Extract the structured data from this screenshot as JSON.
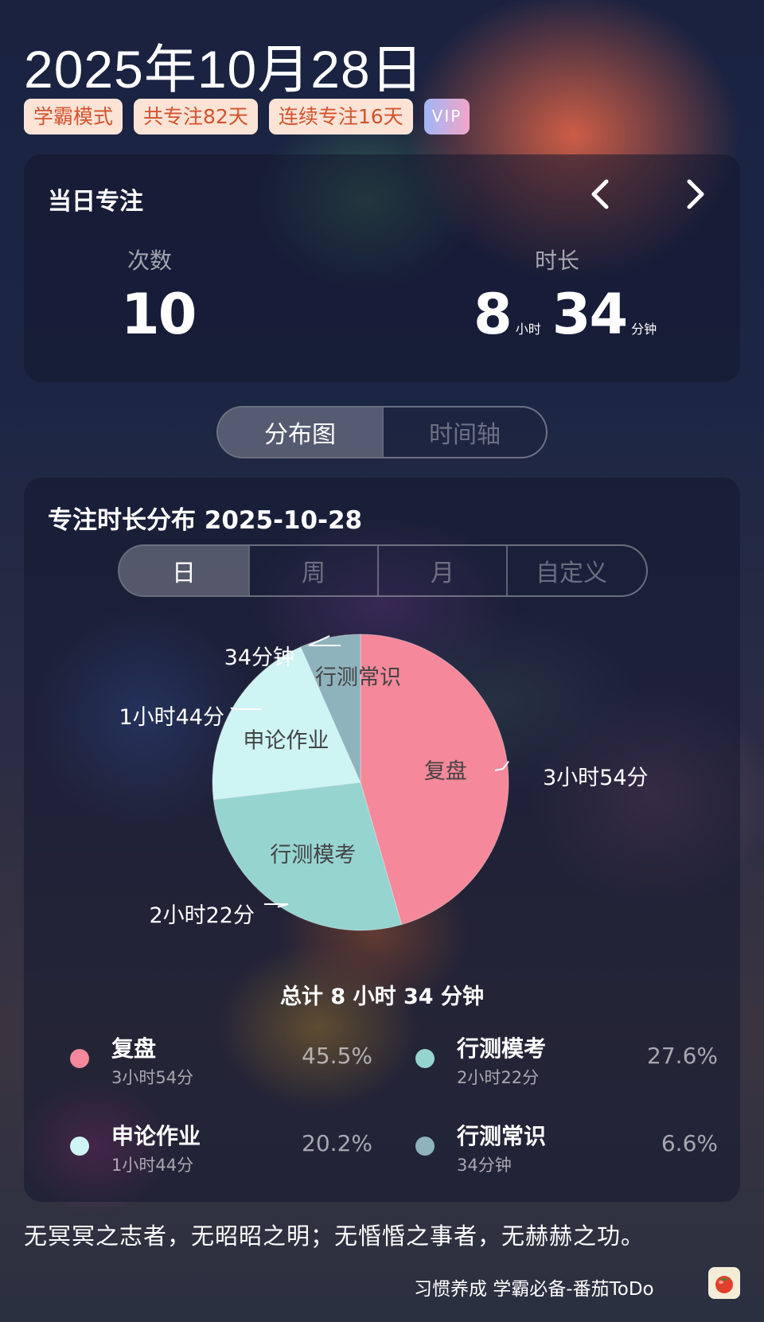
{
  "header": {
    "date": "2025年10月28日",
    "tags": [
      "学霸模式",
      "共专注82天",
      "连续专注16天"
    ],
    "vip": "VIP"
  },
  "focus": {
    "title": "当日专注",
    "count_label": "次数",
    "count_value": "10",
    "duration_label": "时长",
    "hours": "8",
    "hours_unit": "小时",
    "minutes": "34",
    "minutes_unit": "分钟"
  },
  "view_tabs": [
    "分布图",
    "时间轴"
  ],
  "distribution": {
    "title": "专注时长分布  2025-10-28",
    "period_tabs": [
      "日",
      "周",
      "月",
      "自定义"
    ],
    "total": "总计 8 小时 34 分钟"
  },
  "colors": {
    "复盘": "#f5889a",
    "行测模考": "#96d4d0",
    "申论作业": "#cef4f4",
    "行测常识": "#8fb3bd"
  },
  "chart_data": {
    "type": "pie",
    "categories": [
      "复盘",
      "行测模考",
      "申论作业",
      "行测常识"
    ],
    "values": [
      234,
      142,
      104,
      34
    ],
    "value_labels": [
      "3小时54分",
      "2小时22分",
      "1小时44分",
      "34分钟"
    ],
    "percentages": [
      "45.5%",
      "27.6%",
      "20.2%",
      "6.6%"
    ]
  },
  "legend": [
    {
      "name": "复盘",
      "sub": "3小时54分",
      "pct": "45.5%"
    },
    {
      "name": "行测模考",
      "sub": "2小时22分",
      "pct": "27.6%"
    },
    {
      "name": "申论作业",
      "sub": "1小时44分",
      "pct": "20.2%"
    },
    {
      "name": "行测常识",
      "sub": "34分钟",
      "pct": "6.6%"
    }
  ],
  "quote": "无冥冥之志者，无昭昭之明；无惛惛之事者，无赫赫之功。",
  "footer": "习惯养成 学霸必备-番茄ToDo",
  "icons": {
    "prev": "chevron-left-icon",
    "next": "chevron-right-icon",
    "app": "tomato-icon"
  }
}
